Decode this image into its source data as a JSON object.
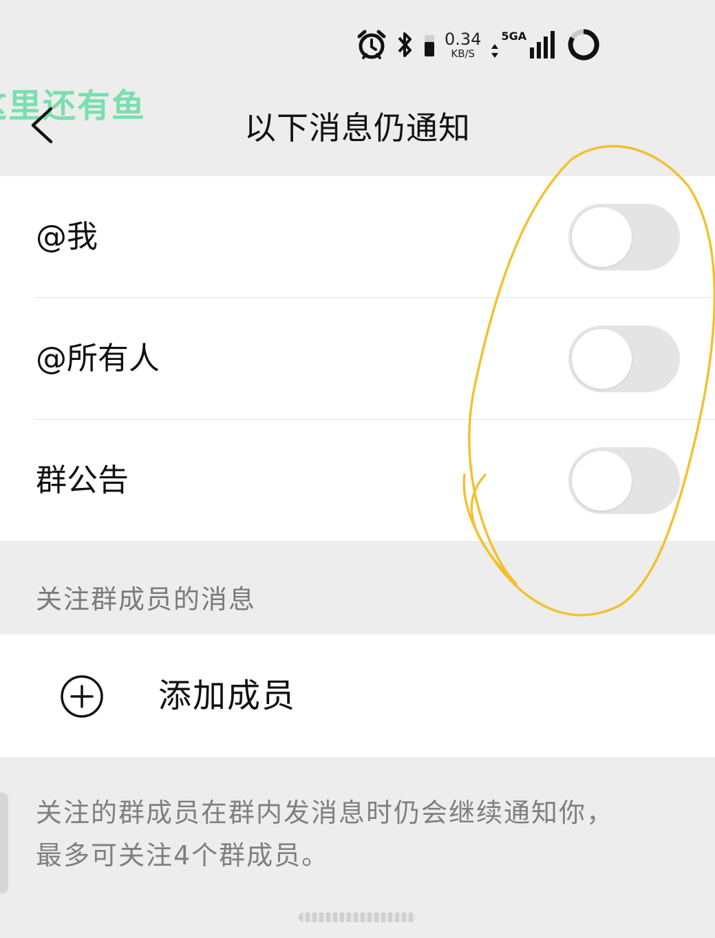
{
  "status_bar": {
    "speed_value": "0.34",
    "speed_unit": "KB/S",
    "network_tag": "5GA",
    "icons": [
      "alarm-icon",
      "bluetooth-icon",
      "battery-small-icon",
      "signal-icon",
      "battery-ring-icon"
    ]
  },
  "watermark": "这里还有鱼",
  "nav": {
    "title": "以下消息仍通知"
  },
  "settings": [
    {
      "label": "@我",
      "enabled": false
    },
    {
      "label": "@所有人",
      "enabled": false
    },
    {
      "label": "群公告",
      "enabled": false
    }
  ],
  "follow_section": {
    "header": "关注群成员的消息",
    "add_label": "添加成员"
  },
  "footnote": {
    "line1": "关注的群成员在群内发消息时仍会继续通知你，",
    "line2": "最多可关注4个群成员。"
  },
  "colors": {
    "page_bg": "#ededed",
    "card_bg": "#ffffff",
    "toggle_off": "#e4e4e4",
    "annotation_stroke": "#f2c12e",
    "watermark": "#66dca4"
  }
}
